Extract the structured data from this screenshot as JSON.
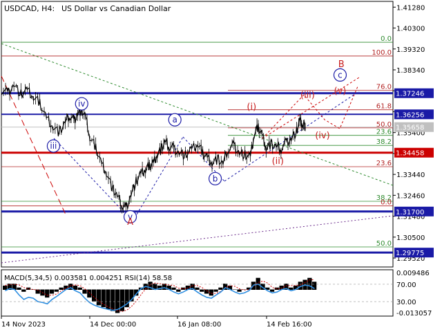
{
  "header": {
    "symbol_tf": "USDCAD, H4:",
    "description": "US Dollar vs Canadian Dollar"
  },
  "colors": {
    "price": "#000000",
    "blue_line": "#1a1aa6",
    "red_line": "#cc0000",
    "dark_red_line": "#8b0000",
    "fib_green": "#2e8b2e",
    "fib_red": "#b22222",
    "label_blue": "#1a1aa6",
    "label_red": "#c81e1e",
    "target_orange": "#e05020",
    "macd_hist": "#000000",
    "macd_signal": "#cc0000",
    "rsi_line": "#2e8ee0",
    "axis_text": "#000000",
    "highlight_label_bg": "#1a1aa6",
    "red_label_bg": "#cc0000",
    "current_price_bg": "#c0c0c0"
  },
  "chart_data": {
    "type": "line",
    "instrument": "USDCAD",
    "timeframe": "H4",
    "title": "USDCAD, H4: US Dollar vs Canadian Dollar",
    "ylim": [
      1.291,
      1.4155
    ],
    "y_ticks": [
      "1.41280",
      "1.40300",
      "1.39320",
      "1.38340",
      "1.37360",
      "1.36380",
      "1.35400",
      "1.34420",
      "1.33440",
      "1.32460",
      "1.31480",
      "1.30500",
      "1.29520"
    ],
    "x_ticks": [
      "14 Nov 2023",
      "14 Dec 00:00",
      "16 Jan 08:00",
      "14 Feb 16:00"
    ],
    "current_price": "1.35658",
    "price_path": [
      {
        "t": 0.0,
        "v": 1.374
      },
      {
        "t": 1.6,
        "v": 1.3725
      },
      {
        "t": 3.2,
        "v": 1.3765
      },
      {
        "t": 5.0,
        "v": 1.372
      },
      {
        "t": 6.6,
        "v": 1.3738
      },
      {
        "t": 8.2,
        "v": 1.3705
      },
      {
        "t": 9.8,
        "v": 1.368
      },
      {
        "t": 11.5,
        "v": 1.361
      },
      {
        "t": 13.2,
        "v": 1.357
      },
      {
        "t": 14.8,
        "v": 1.354
      },
      {
        "t": 16.3,
        "v": 1.359
      },
      {
        "t": 17.5,
        "v": 1.362
      },
      {
        "t": 18.5,
        "v": 1.3595
      },
      {
        "t": 19.5,
        "v": 1.363
      },
      {
        "t": 20.4,
        "v": 1.3645
      },
      {
        "t": 21.5,
        "v": 1.361
      },
      {
        "t": 22.6,
        "v": 1.3515
      },
      {
        "t": 24.1,
        "v": 1.347
      },
      {
        "t": 25.6,
        "v": 1.3395
      },
      {
        "t": 26.8,
        "v": 1.3355
      },
      {
        "t": 28.4,
        "v": 1.3275
      },
      {
        "t": 29.6,
        "v": 1.3245
      },
      {
        "t": 30.8,
        "v": 1.32
      },
      {
        "t": 31.8,
        "v": 1.3183
      },
      {
        "t": 33.1,
        "v": 1.325
      },
      {
        "t": 34.4,
        "v": 1.331
      },
      {
        "t": 35.6,
        "v": 1.3345
      },
      {
        "t": 36.8,
        "v": 1.3365
      },
      {
        "t": 37.8,
        "v": 1.3385
      },
      {
        "t": 38.8,
        "v": 1.3398
      },
      {
        "t": 39.8,
        "v": 1.344
      },
      {
        "t": 40.8,
        "v": 1.346
      },
      {
        "t": 41.8,
        "v": 1.35
      },
      {
        "t": 42.8,
        "v": 1.3475
      },
      {
        "t": 44.0,
        "v": 1.3465
      },
      {
        "t": 45.4,
        "v": 1.3445
      },
      {
        "t": 47.0,
        "v": 1.3435
      },
      {
        "t": 48.6,
        "v": 1.346
      },
      {
        "t": 50.2,
        "v": 1.3485
      },
      {
        "t": 51.4,
        "v": 1.3445
      },
      {
        "t": 52.6,
        "v": 1.3425
      },
      {
        "t": 53.8,
        "v": 1.34
      },
      {
        "t": 55.2,
        "v": 1.3415
      },
      {
        "t": 56.6,
        "v": 1.3395
      },
      {
        "t": 58.0,
        "v": 1.3465
      },
      {
        "t": 59.4,
        "v": 1.348
      },
      {
        "t": 60.8,
        "v": 1.3445
      },
      {
        "t": 62.2,
        "v": 1.3435
      },
      {
        "t": 63.6,
        "v": 1.3425
      },
      {
        "t": 64.6,
        "v": 1.3535
      },
      {
        "t": 65.6,
        "v": 1.3565
      },
      {
        "t": 66.6,
        "v": 1.353
      },
      {
        "t": 67.6,
        "v": 1.347
      },
      {
        "t": 68.8,
        "v": 1.3485
      },
      {
        "t": 70.2,
        "v": 1.3475
      },
      {
        "t": 71.4,
        "v": 1.3465
      },
      {
        "t": 72.8,
        "v": 1.3495
      },
      {
        "t": 74.0,
        "v": 1.351
      },
      {
        "t": 75.4,
        "v": 1.3545
      },
      {
        "t": 76.2,
        "v": 1.3595
      },
      {
        "t": 76.9,
        "v": 1.3575
      },
      {
        "t": 77.6,
        "v": 1.3566
      }
    ],
    "levels": [
      {
        "value": 1.37246,
        "label": "1.37246",
        "style": "blue-thick",
        "label_bg": "blue"
      },
      {
        "value": 1.36256,
        "label": "1.36256",
        "style": "blue-thin",
        "label_bg": "blue"
      },
      {
        "value": 1.34458,
        "label": "1.34458",
        "style": "red-thick",
        "label_bg": "red"
      },
      {
        "value": 1.317,
        "label": "1.31700",
        "style": "blue-thick",
        "label_bg": "blue"
      },
      {
        "value": 1.29775,
        "label": "1.29775",
        "style": "blue-thick",
        "label_bg": "blue"
      }
    ],
    "fib_left": [
      {
        "label": "0.0",
        "value": 1.39635,
        "color": "green"
      },
      {
        "label": "100.0",
        "value": 1.3899,
        "color": "red"
      },
      {
        "label": "23.6",
        "value": 1.338,
        "color": "red"
      },
      {
        "label": "38.2",
        "value": 1.3218,
        "color": "green"
      },
      {
        "label": "0.0",
        "value": 1.31964,
        "color": "red"
      },
      {
        "label": "50.0",
        "value": 1.3004,
        "color": "green"
      }
    ],
    "fib_right": [
      {
        "label": "76.0",
        "value": 1.3738,
        "color": "red"
      },
      {
        "label": "61.8",
        "value": 1.3647,
        "color": "red"
      },
      {
        "label": "50.0",
        "value": 1.3562,
        "color": "red"
      },
      {
        "label": "23.6",
        "value": 1.3527,
        "color": "green"
      },
      {
        "label": "38.2",
        "value": 1.348,
        "color": "green"
      }
    ],
    "wave_labels": [
      {
        "text": "iv",
        "t": 20.5,
        "v": 1.3675,
        "circle": true,
        "color": "blue"
      },
      {
        "text": "iii",
        "t": 13.3,
        "v": 1.3477,
        "circle": true,
        "color": "blue"
      },
      {
        "text": "v",
        "t": 32.9,
        "v": 1.3145,
        "circle": true,
        "color": "blue"
      },
      {
        "text": "A",
        "t": 32.9,
        "v": 1.3121,
        "circle": false,
        "color": "red"
      },
      {
        "text": "a",
        "t": 44.3,
        "v": 1.36,
        "circle": true,
        "color": "blue"
      },
      {
        "text": "b",
        "t": 54.6,
        "v": 1.3324,
        "circle": true,
        "color": "blue"
      },
      {
        "text": "(i)",
        "t": 63.9,
        "v": 1.366,
        "circle": false,
        "color": "red"
      },
      {
        "text": "(ii)",
        "t": 70.6,
        "v": 1.3406,
        "circle": false,
        "color": "red"
      },
      {
        "text": "(iii)",
        "t": 78.2,
        "v": 1.3715,
        "circle": false,
        "color": "red"
      },
      {
        "text": "(iv)",
        "t": 82.0,
        "v": 1.3526,
        "circle": false,
        "color": "red"
      },
      {
        "text": "(v)",
        "t": 86.5,
        "v": 1.3735,
        "circle": false,
        "color": "red"
      },
      {
        "text": "c",
        "t": 86.5,
        "v": 1.381,
        "circle": true,
        "color": "blue"
      },
      {
        "text": "B",
        "t": 86.8,
        "v": 1.386,
        "circle": false,
        "color": "red"
      }
    ],
    "indicator": {
      "label": "MACD(5,34,5) 0.003581 0.004251 RSI(14) 58.58",
      "y_ticks": [
        "0.009486",
        "70.00",
        "30.00",
        "-0.013057"
      ],
      "macd_hist": [
        0.002,
        0.003,
        0.003,
        0.001,
        -0.001,
        0.001,
        0.0,
        -0.002,
        -0.003,
        -0.004,
        -0.002,
        -0.001,
        0.001,
        0.002,
        0.003,
        0.002,
        0.001,
        -0.002,
        -0.004,
        -0.006,
        -0.008,
        -0.009,
        -0.01,
        -0.011,
        -0.012,
        -0.011,
        -0.009,
        -0.006,
        -0.003,
        0.001,
        0.003,
        0.004,
        0.003,
        0.002,
        0.003,
        0.002,
        0.001,
        -0.001,
        0.001,
        0.002,
        0.003,
        0.001,
        -0.001,
        -0.002,
        -0.003,
        -0.001,
        0.001,
        0.003,
        0.002,
        0.0,
        -0.001,
        0.0,
        0.001,
        0.004,
        0.006,
        0.003,
        0.001,
        -0.001,
        0.001,
        0.002,
        0.003,
        0.001,
        0.002,
        0.004,
        0.005,
        0.006,
        0.004
      ],
      "rsi": [
        55,
        60,
        58,
        45,
        35,
        40,
        38,
        30,
        28,
        25,
        35,
        42,
        50,
        58,
        62,
        55,
        50,
        38,
        28,
        22,
        18,
        15,
        12,
        10,
        12,
        18,
        25,
        35,
        48,
        60,
        65,
        62,
        58,
        60,
        62,
        58,
        52,
        48,
        52,
        58,
        60,
        52,
        45,
        40,
        38,
        45,
        52,
        62,
        58,
        52,
        48,
        50,
        55,
        68,
        70,
        62,
        55,
        50,
        52,
        58,
        60,
        55,
        58,
        65,
        68,
        66,
        60
      ]
    }
  }
}
